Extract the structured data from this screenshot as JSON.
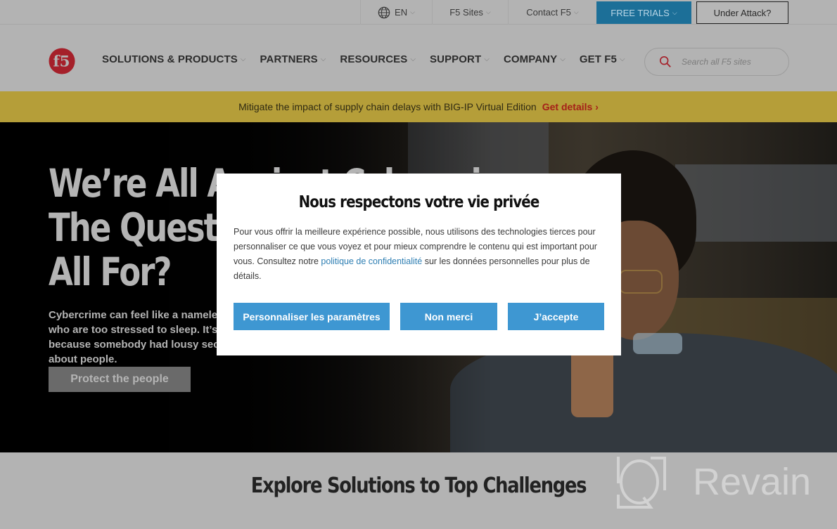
{
  "utility_bar": {
    "language": "EN",
    "f5_sites": "F5 Sites",
    "contact": "Contact F5",
    "free_trials": "FREE TRIALS",
    "under_attack": "Under Attack?"
  },
  "nav": {
    "logo_alt": "F5",
    "items": [
      {
        "label": "SOLUTIONS & PRODUCTS"
      },
      {
        "label": "PARTNERS"
      },
      {
        "label": "RESOURCES"
      },
      {
        "label": "SUPPORT"
      },
      {
        "label": "COMPANY"
      },
      {
        "label": "GET F5"
      }
    ],
    "search_placeholder": "Search all F5 sites"
  },
  "promo": {
    "text": "Mitigate the impact of supply chain delays with BIG-IP Virtual Edition",
    "link": "Get details ›"
  },
  "hero": {
    "title_lines": [
      "We’re All Against Cybercrime.",
      "The Question Is, What Are We",
      "All For?"
    ],
    "body": "Cybercrime can feel like a nameless, faceless threat. But it’s about people who are too stressed to sleep. It’s about shoppers who lose their savings because somebody had lousy security. It’s about business, sure, but it’s also about people.",
    "button": "Protect the people"
  },
  "explore": {
    "title": "Explore Solutions to Top Challenges"
  },
  "watermark": {
    "text": "Revain"
  },
  "consent_modal": {
    "title": "Nous respectons votre vie privée",
    "body_before_link": "Pour vous offrir la meilleure expérience possible, nous utilisons des technologies tierces pour personnaliser ce que vous voyez et pour mieux comprendre le contenu qui est important pour vous. Consultez notre ",
    "link": "politique de confidentialité",
    "body_after_link": " sur les données personnelles pour plus de détails.",
    "buttons": {
      "customize": "Personnaliser les paramètres",
      "decline": "Non merci",
      "accept": "J’accepte"
    }
  },
  "colors": {
    "brand_red": "#a5202a",
    "trials_blue": "#1c6f98",
    "promo_gold": "#b59e39",
    "modal_button_blue": "#3e97d2",
    "link_blue": "#2f7fb3"
  }
}
